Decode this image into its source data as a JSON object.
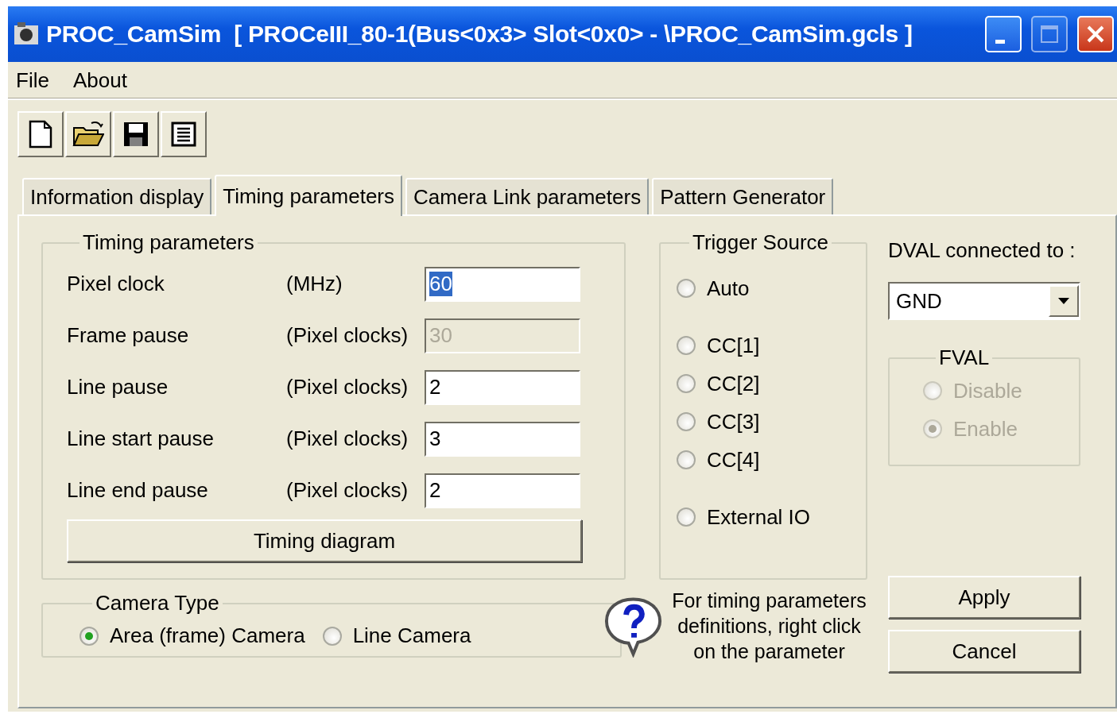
{
  "window": {
    "title": "PROC_CamSim  [ PROCeIII_80-1(Bus<0x3> Slot<0x0> - \\PROC_CamSim.gcls ]"
  },
  "menu": [
    {
      "label": "File"
    },
    {
      "label": "About"
    }
  ],
  "toolbar": [
    {
      "kind": "new"
    },
    {
      "kind": "open"
    },
    {
      "kind": "save"
    },
    {
      "kind": "list"
    }
  ],
  "tabs": [
    {
      "label": "Information display",
      "selected": false
    },
    {
      "label": "Timing parameters",
      "selected": true
    },
    {
      "label": "Camera Link parameters",
      "selected": false
    },
    {
      "label": "Pattern Generator",
      "selected": false
    }
  ],
  "timing": {
    "title": "Timing parameters",
    "rows": [
      {
        "label": "Pixel clock",
        "unit": "(MHz)",
        "value": "60",
        "disabled": false,
        "highlighted": true
      },
      {
        "label": "Frame pause",
        "unit": "(Pixel clocks)",
        "value": "30",
        "disabled": true,
        "highlighted": false
      },
      {
        "label": "Line pause",
        "unit": "(Pixel clocks)",
        "value": "2",
        "disabled": false,
        "highlighted": false
      },
      {
        "label": "Line start pause",
        "unit": "(Pixel clocks)",
        "value": "3",
        "disabled": false,
        "highlighted": false
      },
      {
        "label": "Line end pause",
        "unit": "(Pixel clocks)",
        "value": "2",
        "disabled": false,
        "highlighted": false
      }
    ],
    "diagram_button": "Timing diagram"
  },
  "trigger": {
    "title": "Trigger Source",
    "options": [
      {
        "label": "Auto",
        "selected": false
      },
      {
        "label": "CC[1]",
        "selected": false
      },
      {
        "label": "CC[2]",
        "selected": false
      },
      {
        "label": "CC[3]",
        "selected": false
      },
      {
        "label": "CC[4]",
        "selected": false
      },
      {
        "label": "External IO",
        "selected": false
      }
    ]
  },
  "dval": {
    "label": "DVAL connected to :",
    "value": "GND"
  },
  "fval": {
    "title": "FVAL",
    "disabled": true,
    "options": [
      {
        "label": "Disable",
        "selected": false
      },
      {
        "label": "Enable",
        "selected": true
      }
    ]
  },
  "camera_type": {
    "title": "Camera Type",
    "options": [
      {
        "label": "Area (frame) Camera",
        "selected": true
      },
      {
        "label": "Line Camera",
        "selected": false
      }
    ]
  },
  "help_text": "For timing parameters definitions, right click on the parameter",
  "buttons": [
    "Apply",
    "Cancel"
  ]
}
